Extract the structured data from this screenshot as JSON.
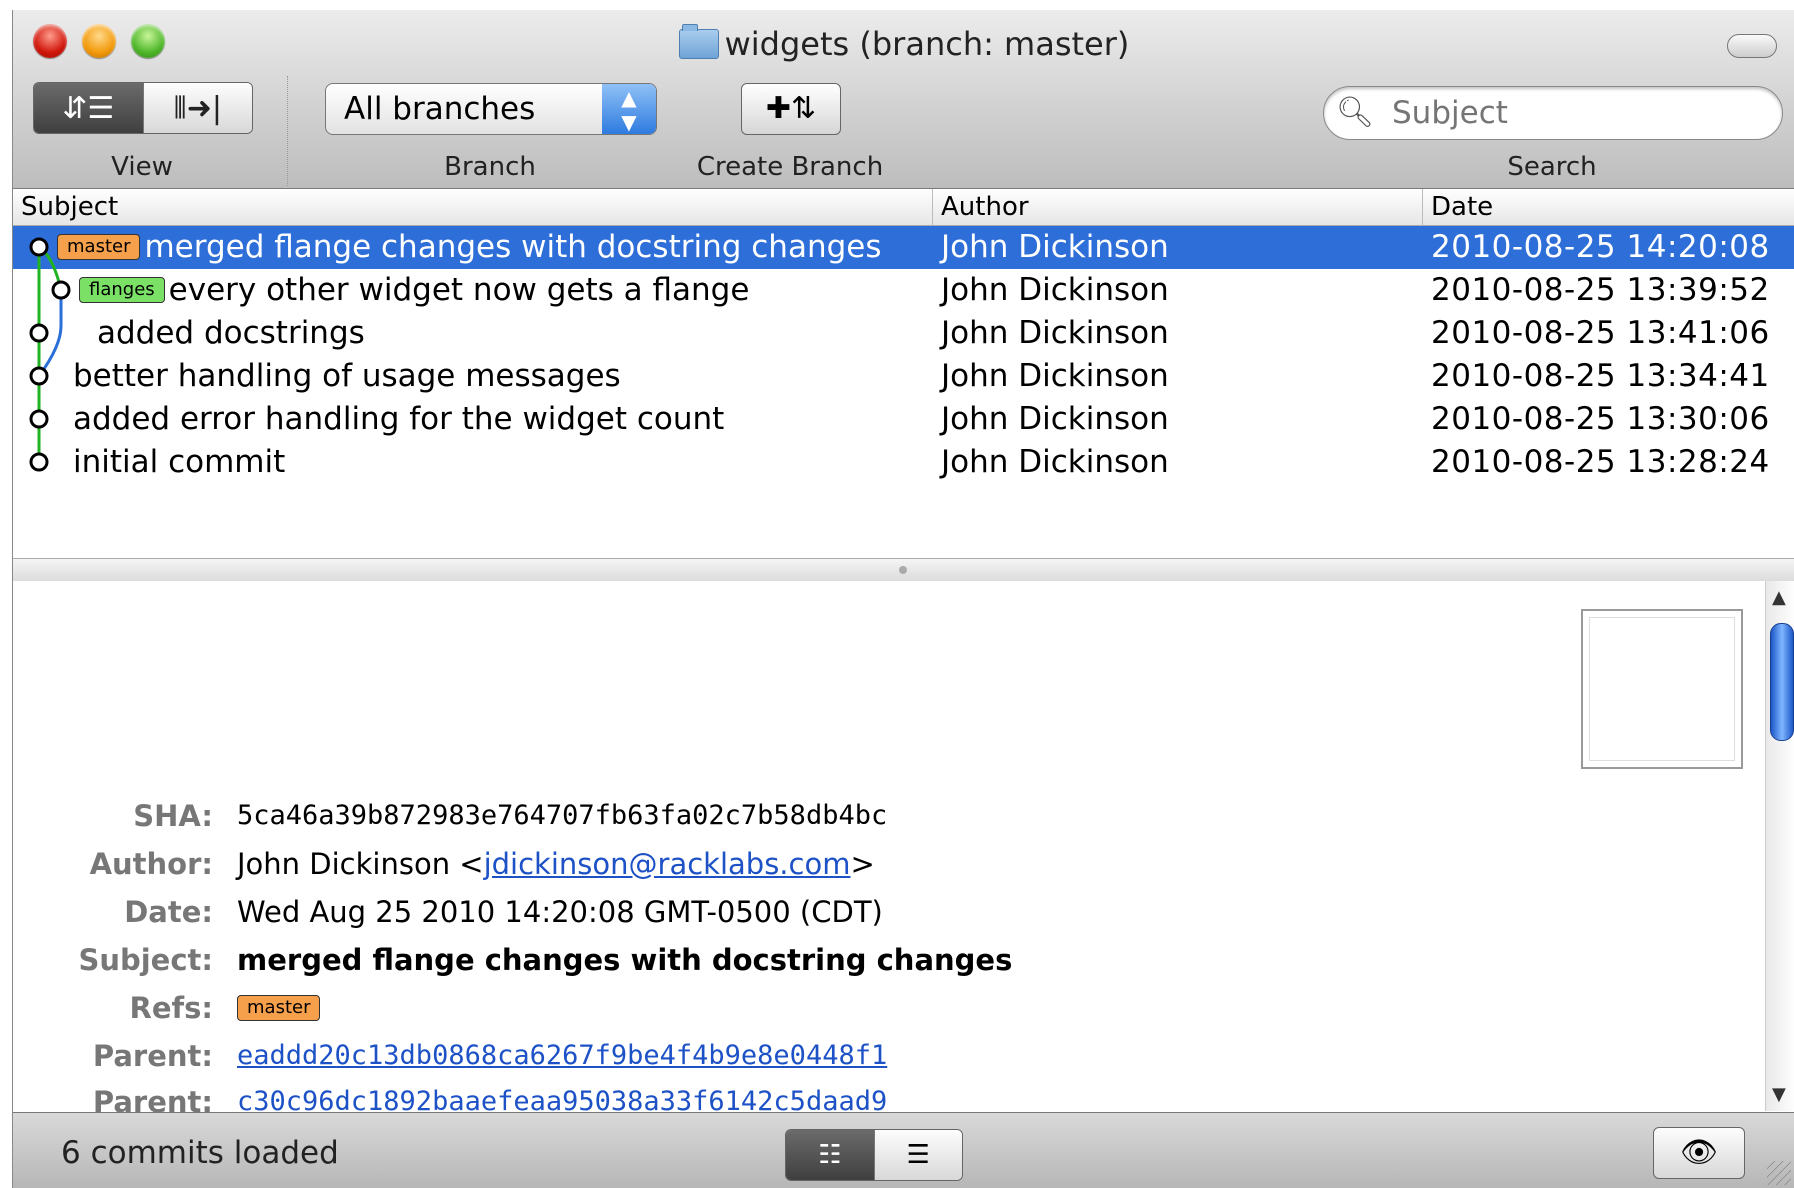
{
  "window": {
    "title": "widgets (branch: master)"
  },
  "toolbar": {
    "view_label": "View",
    "branch_label": "Branch",
    "branch_value": "All branches",
    "create_branch_label": "Create Branch",
    "search_label": "Search",
    "search_placeholder": "Subject"
  },
  "table": {
    "columns": [
      "Subject",
      "Author",
      "Date"
    ],
    "rows": [
      {
        "ref": "master",
        "ref_color": "#f6a04b",
        "subject": "merged flange changes with docstring changes",
        "author": "John Dickinson",
        "date": "2010-08-25 14:20:08",
        "selected": true
      },
      {
        "ref": "flanges",
        "ref_color": "#7be066",
        "subject": "every other widget now gets a flange",
        "author": "John Dickinson",
        "date": "2010-08-25 13:39:52"
      },
      {
        "subject": "added docstrings",
        "author": "John Dickinson",
        "date": "2010-08-25 13:41:06"
      },
      {
        "subject": "better handling of usage messages",
        "author": "John Dickinson",
        "date": "2010-08-25 13:34:41"
      },
      {
        "subject": "added error handling for the widget count",
        "author": "John Dickinson",
        "date": "2010-08-25 13:30:06"
      },
      {
        "subject": "initial commit",
        "author": "John Dickinson",
        "date": "2010-08-25 13:28:24"
      }
    ]
  },
  "detail": {
    "sha_label": "SHA:",
    "sha": "5ca46a39b872983e764707fb63fa02c7b58db4bc",
    "author_label": "Author:",
    "author_name": "John Dickinson <",
    "author_email": "jdickinson@racklabs.com",
    "author_close": ">",
    "date_label": "Date:",
    "date": "Wed Aug 25 2010 14:20:08 GMT-0500 (CDT)",
    "subject_label": "Subject:",
    "subject": "merged flange changes with docstring changes",
    "refs_label": "Refs:",
    "refs": "master",
    "parent_label": "Parent:",
    "parents": [
      "eaddd20c13db0868ca6267f9be4f4b9e8e0448f1",
      "c30c96dc1892baaefeaa95038a33f6142c5daad9"
    ]
  },
  "status": {
    "text": "6 commits loaded"
  },
  "colors": {
    "selection": "#2d6ed9",
    "graph_green": "#22b322",
    "graph_blue": "#2a6fd8",
    "link": "#1d52c7"
  },
  "icons": [
    "history-view-icon",
    "commit-view-icon",
    "create-branch-icon",
    "search-icon",
    "eye-icon"
  ]
}
